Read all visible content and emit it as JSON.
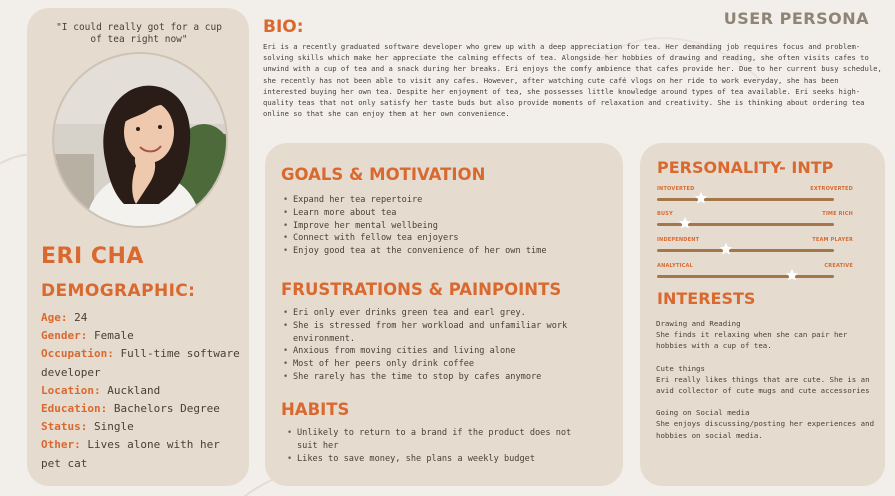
{
  "header": {
    "title": "USER PERSONA"
  },
  "profile": {
    "quote": "\"I could really got for a cup of tea right now\"",
    "name": "ERI CHA",
    "demographic_title": "DEMOGRAPHIC:",
    "demographics": [
      {
        "key": "Age:",
        "value": " 24"
      },
      {
        "key": "Gender:",
        "value": " Female"
      },
      {
        "key": "Occupation:",
        "value": " Full-time software developer"
      },
      {
        "key": "Location:",
        "value": "  Auckland"
      },
      {
        "key": "Education:",
        "value": " Bachelors Degree"
      },
      {
        "key": "Status:",
        "value": " Single"
      },
      {
        "key": "Other:",
        "value": " Lives alone with her pet cat"
      }
    ]
  },
  "bio": {
    "title": "BIO:",
    "text": "Eri is a recently graduated software developer who grew up with a deep appreciation for tea. Her demanding job requires focus and problem-solving skills which make her appreciate the calming effects of tea. Alongside her hobbies of drawing and reading, she often visits cafes to unwind with a cup of tea and a snack during her breaks. Eri enjoys the comfy ambience that cafes provide her. Due to her current busy schedule, she recently has not been able to visit any cafes. However, after watching cute café vlogs on her ride to work everyday, she has been interested buying her own tea. Despite her enjoyment of tea, she possesses little knowledge around types of tea available. Eri seeks high-quality teas that not only satisfy her taste buds but also provide moments of relaxation and creativity.  She is thinking about ordering tea online so that she can enjoy them at her own convenience."
  },
  "goals": {
    "title": "GOALS & MOTIVATION",
    "items": [
      "Expand her tea repertoire",
      "Learn more about tea",
      "Improve her mental wellbeing",
      "Connect with fellow tea enjoyers",
      "Enjoy good tea at the convenience of her own time"
    ]
  },
  "frustrations": {
    "title": "FRUSTRATIONS & PAINPOINTS",
    "items": [
      "Eri only ever drinks green tea and earl grey.",
      "She is stressed from her workload and unfamiliar work environment.",
      "Anxious from moving cities and living alone",
      "Most of her peers only drink coffee",
      "She rarely has the time to stop by cafes anymore"
    ]
  },
  "habits": {
    "title": "HABITS",
    "items": [
      "Unlikely to return to a brand if the product does not suit her",
      "Likes to save money, she plans a weekly budget"
    ]
  },
  "personality": {
    "title": "PERSONALITY- INTP",
    "accent_color": "#d9692f",
    "track_color": "#a4774a",
    "scales": [
      {
        "left": "INTOVERTED",
        "right": "EXTROVERTED",
        "value": 0.25
      },
      {
        "left": "BUSY",
        "right": "TIME RICH",
        "value": 0.16
      },
      {
        "left": "INDEPENDENT",
        "right": "TEAM PLAYER",
        "value": 0.39
      },
      {
        "left": "ANALYTICAL",
        "right": "CREATIVE",
        "value": 0.76
      }
    ]
  },
  "interests": {
    "title": "INTERESTS",
    "groups": [
      {
        "heading": "Drawing and Reading",
        "text": "She finds it relaxing when she can pair her hobbies with a cup of tea."
      },
      {
        "heading": "Cute things",
        "text": "Eri really likes things that are cute. She is an avid collector of cute mugs and cute accessories"
      },
      {
        "heading": "Going on Social media",
        "text": "She enjoys discussing/posting her experiences and hobbies on social media."
      }
    ]
  },
  "icons": {
    "slider_knob": "star-icon",
    "photo": "profile-photo"
  }
}
